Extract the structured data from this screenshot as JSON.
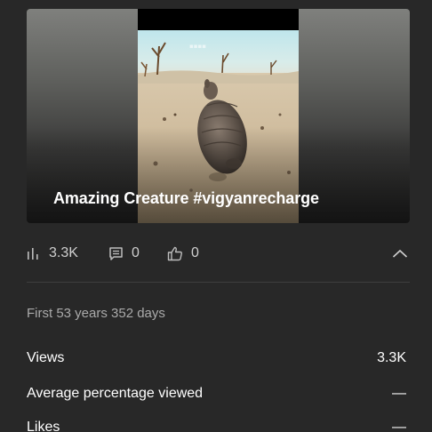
{
  "video": {
    "title": "Amazing Creature #vigyanrecharge",
    "thumbnail_icon": "armadillo-on-sand-thumbnail"
  },
  "stats": {
    "views": "3.3K",
    "comments": "0",
    "likes": "0"
  },
  "icons": {
    "views": "bar-chart-icon",
    "comments": "comment-icon",
    "likes": "thumbs-up-icon",
    "collapse": "chevron-up-icon"
  },
  "period_label": "First 53 years 352 days",
  "metrics": [
    {
      "label": "Views",
      "value": "3.3K"
    },
    {
      "label": "Average percentage viewed",
      "value": "—"
    },
    {
      "label": "Likes",
      "value": "—"
    }
  ],
  "colors": {
    "background": "#282828",
    "text_primary": "#ffffff",
    "text_secondary": "#aaaaaa",
    "divider": "#3e3e3e"
  }
}
